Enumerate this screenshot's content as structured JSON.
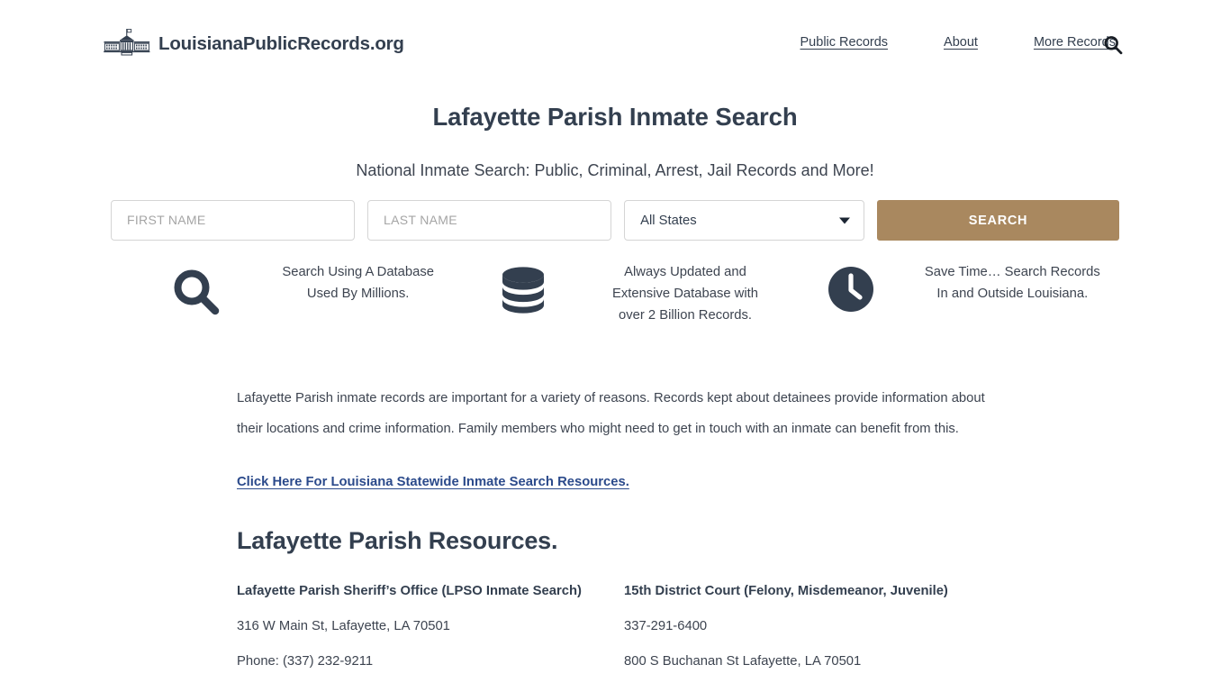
{
  "header": {
    "brand_name": "LouisianaPublicRecords.org",
    "brand_icon": "white-house-icon",
    "nav": [
      {
        "label": "Public Records"
      },
      {
        "label": "About"
      },
      {
        "label": "More Records"
      }
    ],
    "search_icon": "search-icon"
  },
  "hero": {
    "title": "Lafayette Parish Inmate Search",
    "subtitle": "National Inmate Search: Public, Criminal, Arrest, Jail Records and More!"
  },
  "search_form": {
    "first_name_value": "",
    "first_name_placeholder": "FIRST NAME",
    "last_name_value": "",
    "last_name_placeholder": "LAST NAME",
    "state_selected": "All States",
    "state_options": [
      "All States"
    ],
    "submit_label": "SEARCH",
    "submit_color": "#a9885f",
    "caret_icon": "chevron-down-icon"
  },
  "features": [
    {
      "icon": "magnifier-icon",
      "text": "Search Using A Database Used By Millions."
    },
    {
      "icon": "database-icon",
      "text": "Always Updated and Extensive Database with over 2 Billion Records."
    },
    {
      "icon": "clock-icon",
      "text": "Save Time… Search Records In and Outside Louisiana."
    }
  ],
  "content": {
    "paragraph": "Lafayette Parish inmate records are important for a variety of reasons. Records kept about detainees provide information about their locations and crime information. Family members who might need to get in touch with an inmate can benefit from this.",
    "statewide_link": "Click Here For Louisiana Statewide Inmate Search Resources.",
    "statewide_link_color": "#2b4a8b",
    "resources_heading": "Lafayette Parish Resources.",
    "resources": [
      {
        "title": "Lafayette Parish Sheriff’s Office (LPSO Inmate Search)",
        "lines": [
          "316 W Main St, Lafayette, LA 70501",
          "Phone: (337) 232-9211"
        ]
      },
      {
        "title": "15th District Court (Felony, Misdemeanor, Juvenile)",
        "lines": [
          "337-291-6400",
          "800 S Buchanan St Lafayette, LA 70501"
        ]
      }
    ]
  },
  "theme": {
    "ink": "#333f4f",
    "body_text": "#3d4450",
    "accent": "#a9885f",
    "link": "#2b4a8b",
    "background": "#ffffff"
  }
}
